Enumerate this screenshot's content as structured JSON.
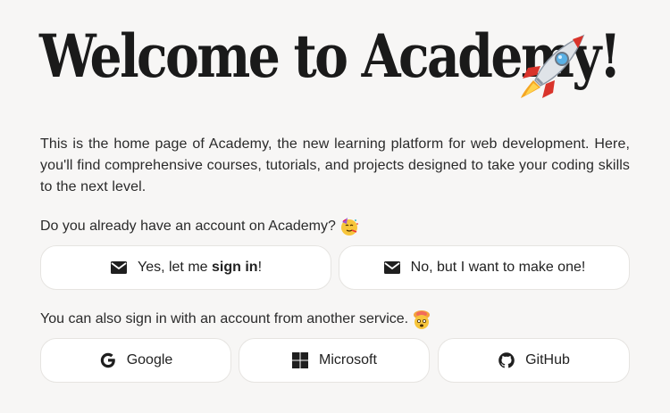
{
  "header": {
    "title": "Welcome to Academy!"
  },
  "intro": "This is the home page of Academy, the new learning platform for web development. Here, you'll find comprehensive courses, tutorials, and projects designed to take your coding skills to the next level.",
  "account_prompt": "Do you already have an account on Academy?",
  "buttons": {
    "yes_prefix": "Yes, let me ",
    "yes_bold": "sign in",
    "yes_suffix": "!",
    "no_label": "No, but I want to make one!"
  },
  "other_prompt": "You can also sign in with an account from another service.",
  "services": {
    "google": "Google",
    "microsoft": "Microsoft",
    "github": "GitHub"
  },
  "icons": {
    "title": "rocket-icon",
    "account_prompt": "partying-face-icon",
    "other_prompt": "exploding-head-icon",
    "yes": "envelope-icon",
    "no": "envelope-icon",
    "google": "google-icon",
    "microsoft": "microsoft-icon",
    "github": "github-icon"
  },
  "colors": {
    "background": "#f7f6f5",
    "button_bg": "#ffffff",
    "button_border": "#e6e4e1",
    "text": "#222222"
  }
}
